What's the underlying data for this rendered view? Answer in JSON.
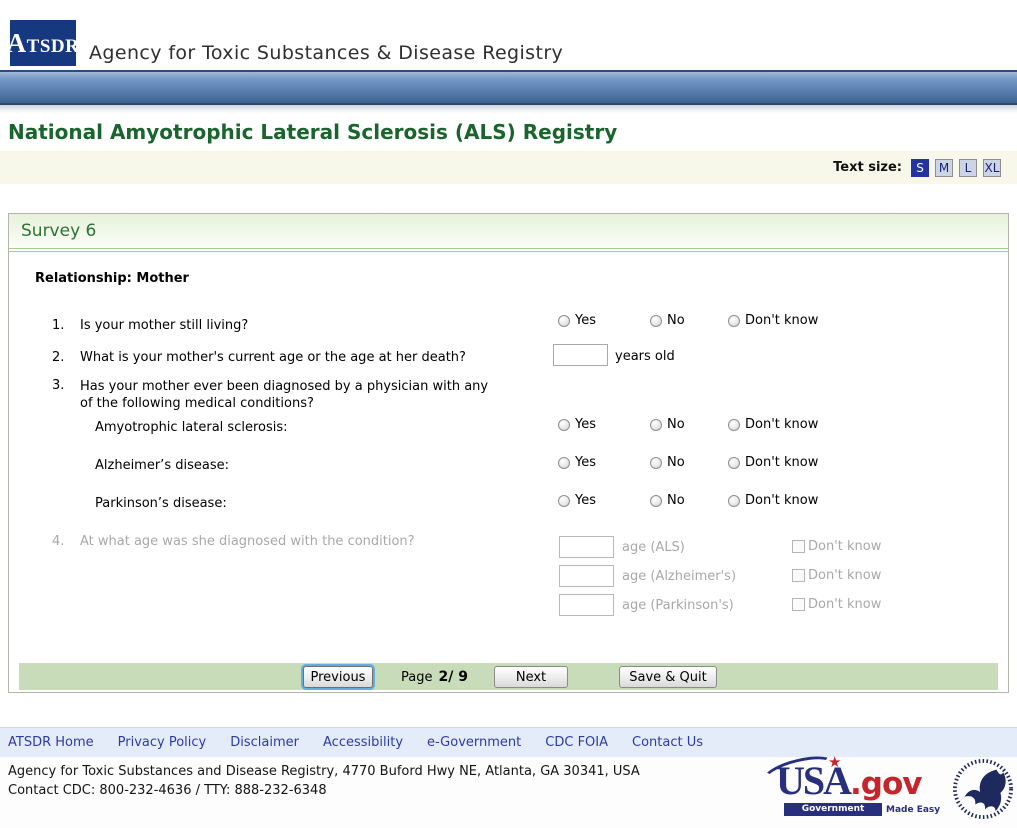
{
  "header": {
    "logo": "ATSDR",
    "agency": "Agency for Toxic Substances & Disease Registry"
  },
  "title": "National Amyotrophic Lateral Sclerosis (ALS) Registry",
  "text_size": {
    "label": "Text size:",
    "sizes": [
      "S",
      "M",
      "L",
      "XL"
    ],
    "active": "S"
  },
  "survey": {
    "heading": "Survey 6",
    "relationship": "Relationship: Mother",
    "radio_options": [
      "Yes",
      "No",
      "Don't know"
    ],
    "q1": {
      "number": "1.",
      "text": "Is your mother still living?"
    },
    "q2": {
      "number": "2.",
      "text": "What is your mother's current age or the age at her death?",
      "value": "",
      "suffix": "years old"
    },
    "q3": {
      "number": "3.",
      "text": "Has your mother ever been diagnosed by a physician with any of the following medical conditions?",
      "conditions": [
        "Amyotrophic lateral sclerosis:",
        "Alzheimer’s disease:",
        "Parkinson’s disease:"
      ]
    },
    "q4": {
      "number": "4.",
      "text": "At what age was she diagnosed with the condition?",
      "rows": [
        {
          "value": "",
          "label": "age (ALS)",
          "checkbox": "Don't know"
        },
        {
          "value": "",
          "label": "age (Alzheimer's)",
          "checkbox": "Don't know"
        },
        {
          "value": "",
          "label": "age (Parkinson's)",
          "checkbox": "Don't know"
        }
      ]
    }
  },
  "nav": {
    "previous": "Previous",
    "page_label": "Page",
    "page_value": "2/ 9",
    "next": "Next",
    "save_quit": "Save & Quit"
  },
  "footer": {
    "links": [
      "ATSDR Home",
      "Privacy Policy",
      "Disclaimer",
      "Accessibility",
      "e-Government",
      "CDC FOIA",
      "Contact Us"
    ],
    "address": "Agency for Toxic Substances and Disease Registry, 4770 Buford Hwy NE, Atlanta, GA 30341, USA",
    "contact": "Contact CDC: 800-232-4636 / TTY: 888-232-6348",
    "usagov": {
      "usa": "USA",
      "gov": ".gov",
      "tagline_left": "Government",
      "tagline_right": "Made Easy",
      "star": "★"
    }
  },
  "colors": {
    "header_navy": "#16387e",
    "title_green": "#1a652e",
    "survey_green": "#2c7233",
    "nav_bar_green": "#c9dcb9",
    "link_blue": "#2b3ba6",
    "usagov_red": "#c5262c"
  }
}
